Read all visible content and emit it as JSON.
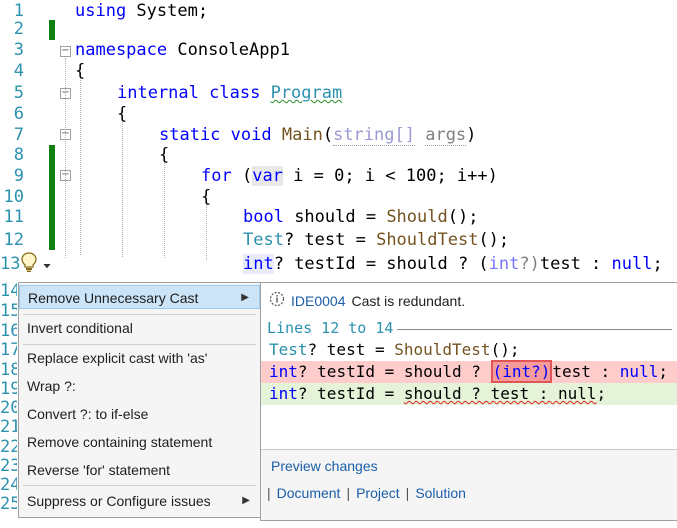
{
  "editor": {
    "line_numbers": [
      "1",
      "2",
      "3",
      "4",
      "5",
      "6",
      "7",
      "8",
      "9",
      "10",
      "11",
      "12",
      "13",
      "14",
      "15",
      "16",
      "17",
      "18",
      "19",
      "20",
      "21",
      "22",
      "23",
      "24",
      "25"
    ],
    "lines": {
      "l1": {
        "kw": "using",
        "rest": " System;"
      },
      "l3": {
        "kw": "namespace",
        "rest": " ConsoleApp1"
      },
      "l4": "{",
      "l5": {
        "kw1": "internal",
        "kw2": "class",
        "type": "Program"
      },
      "l6": "{",
      "l7": {
        "kw1": "static",
        "kw2": "void",
        "fn": "Main",
        "p_type": "string[]",
        "p_name": "args"
      },
      "l8": "{",
      "l9": {
        "kw1": "for",
        "kw2": "var",
        "mid": " i = 0; i < 100; i++)"
      },
      "l10": "{",
      "l11": {
        "kw": "bool",
        "mid": " should = ",
        "fn": "Should",
        "end": "();"
      },
      "l12": {
        "type": "Test",
        "mid": "? test = ",
        "fn": "ShouldTest",
        "end": "();"
      },
      "l13": {
        "kw": "int",
        "mid": "? testId = should ? (",
        "cast_kw": "int",
        "cast_end": "?)",
        "end": "test : ",
        "null": "null",
        "semi": ";"
      },
      "l25_partial": "l.     Dlo  ()  Nl  ( )"
    }
  },
  "lightbulb": {
    "icon": "lightbulb-icon",
    "dropdown": "chevron-down-icon"
  },
  "quick_actions_menu": {
    "items": [
      {
        "label": "Remove Unnecessary Cast",
        "has_submenu": true,
        "selected": true
      },
      {
        "label": "Invert conditional"
      },
      {
        "label": "Replace explicit cast with 'as'"
      },
      {
        "label": "Wrap ?:"
      },
      {
        "label": "Convert ?: to if-else"
      },
      {
        "label": "Remove containing statement"
      },
      {
        "label": "Reverse 'for' statement"
      },
      {
        "label": "Suppress or Configure issues",
        "has_submenu": true
      }
    ],
    "submenu_arrow": "▶"
  },
  "preview": {
    "diagnostic_id": "IDE0004",
    "diagnostic_msg": "Cast is redundant.",
    "lines_header": "Lines 12 to 14",
    "code": {
      "l1": {
        "type": "Test",
        "mid": "? test = ",
        "fn": "ShouldTest",
        "end": "();"
      },
      "removed": {
        "kw": "int",
        "mid": "? testId = should ? ",
        "cast": "(int?)",
        "end": "test : ",
        "null": "null",
        "semi": ";"
      },
      "added": {
        "kw": "int",
        "mid": "? testId = ",
        "sq": "should ? test : null",
        "semi": ";"
      }
    },
    "preview_changes": "Preview changes",
    "scope_links": [
      "Document",
      "Project",
      "Solution"
    ],
    "separator": "|"
  },
  "colors": {
    "keyword": "#0000ff",
    "type": "#2b91af",
    "method": "#74531f",
    "removed_bg": "#ffcccc",
    "added_bg": "#e5f3d9",
    "link": "#1a5ea8",
    "change_bar": "#108010"
  }
}
